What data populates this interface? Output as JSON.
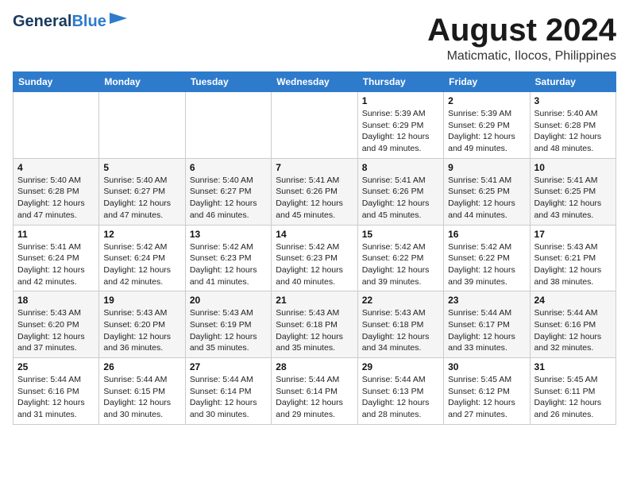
{
  "header": {
    "logo_general": "General",
    "logo_blue": "Blue",
    "title": "August 2024",
    "subtitle": "Maticmatic, Ilocos, Philippines"
  },
  "calendar": {
    "days_of_week": [
      "Sunday",
      "Monday",
      "Tuesday",
      "Wednesday",
      "Thursday",
      "Friday",
      "Saturday"
    ],
    "weeks": [
      [
        {
          "day": "",
          "info": ""
        },
        {
          "day": "",
          "info": ""
        },
        {
          "day": "",
          "info": ""
        },
        {
          "day": "",
          "info": ""
        },
        {
          "day": "1",
          "info": "Sunrise: 5:39 AM\nSunset: 6:29 PM\nDaylight: 12 hours\nand 49 minutes."
        },
        {
          "day": "2",
          "info": "Sunrise: 5:39 AM\nSunset: 6:29 PM\nDaylight: 12 hours\nand 49 minutes."
        },
        {
          "day": "3",
          "info": "Sunrise: 5:40 AM\nSunset: 6:28 PM\nDaylight: 12 hours\nand 48 minutes."
        }
      ],
      [
        {
          "day": "4",
          "info": "Sunrise: 5:40 AM\nSunset: 6:28 PM\nDaylight: 12 hours\nand 47 minutes."
        },
        {
          "day": "5",
          "info": "Sunrise: 5:40 AM\nSunset: 6:27 PM\nDaylight: 12 hours\nand 47 minutes."
        },
        {
          "day": "6",
          "info": "Sunrise: 5:40 AM\nSunset: 6:27 PM\nDaylight: 12 hours\nand 46 minutes."
        },
        {
          "day": "7",
          "info": "Sunrise: 5:41 AM\nSunset: 6:26 PM\nDaylight: 12 hours\nand 45 minutes."
        },
        {
          "day": "8",
          "info": "Sunrise: 5:41 AM\nSunset: 6:26 PM\nDaylight: 12 hours\nand 45 minutes."
        },
        {
          "day": "9",
          "info": "Sunrise: 5:41 AM\nSunset: 6:25 PM\nDaylight: 12 hours\nand 44 minutes."
        },
        {
          "day": "10",
          "info": "Sunrise: 5:41 AM\nSunset: 6:25 PM\nDaylight: 12 hours\nand 43 minutes."
        }
      ],
      [
        {
          "day": "11",
          "info": "Sunrise: 5:41 AM\nSunset: 6:24 PM\nDaylight: 12 hours\nand 42 minutes."
        },
        {
          "day": "12",
          "info": "Sunrise: 5:42 AM\nSunset: 6:24 PM\nDaylight: 12 hours\nand 42 minutes."
        },
        {
          "day": "13",
          "info": "Sunrise: 5:42 AM\nSunset: 6:23 PM\nDaylight: 12 hours\nand 41 minutes."
        },
        {
          "day": "14",
          "info": "Sunrise: 5:42 AM\nSunset: 6:23 PM\nDaylight: 12 hours\nand 40 minutes."
        },
        {
          "day": "15",
          "info": "Sunrise: 5:42 AM\nSunset: 6:22 PM\nDaylight: 12 hours\nand 39 minutes."
        },
        {
          "day": "16",
          "info": "Sunrise: 5:42 AM\nSunset: 6:22 PM\nDaylight: 12 hours\nand 39 minutes."
        },
        {
          "day": "17",
          "info": "Sunrise: 5:43 AM\nSunset: 6:21 PM\nDaylight: 12 hours\nand 38 minutes."
        }
      ],
      [
        {
          "day": "18",
          "info": "Sunrise: 5:43 AM\nSunset: 6:20 PM\nDaylight: 12 hours\nand 37 minutes."
        },
        {
          "day": "19",
          "info": "Sunrise: 5:43 AM\nSunset: 6:20 PM\nDaylight: 12 hours\nand 36 minutes."
        },
        {
          "day": "20",
          "info": "Sunrise: 5:43 AM\nSunset: 6:19 PM\nDaylight: 12 hours\nand 35 minutes."
        },
        {
          "day": "21",
          "info": "Sunrise: 5:43 AM\nSunset: 6:18 PM\nDaylight: 12 hours\nand 35 minutes."
        },
        {
          "day": "22",
          "info": "Sunrise: 5:43 AM\nSunset: 6:18 PM\nDaylight: 12 hours\nand 34 minutes."
        },
        {
          "day": "23",
          "info": "Sunrise: 5:44 AM\nSunset: 6:17 PM\nDaylight: 12 hours\nand 33 minutes."
        },
        {
          "day": "24",
          "info": "Sunrise: 5:44 AM\nSunset: 6:16 PM\nDaylight: 12 hours\nand 32 minutes."
        }
      ],
      [
        {
          "day": "25",
          "info": "Sunrise: 5:44 AM\nSunset: 6:16 PM\nDaylight: 12 hours\nand 31 minutes."
        },
        {
          "day": "26",
          "info": "Sunrise: 5:44 AM\nSunset: 6:15 PM\nDaylight: 12 hours\nand 30 minutes."
        },
        {
          "day": "27",
          "info": "Sunrise: 5:44 AM\nSunset: 6:14 PM\nDaylight: 12 hours\nand 30 minutes."
        },
        {
          "day": "28",
          "info": "Sunrise: 5:44 AM\nSunset: 6:14 PM\nDaylight: 12 hours\nand 29 minutes."
        },
        {
          "day": "29",
          "info": "Sunrise: 5:44 AM\nSunset: 6:13 PM\nDaylight: 12 hours\nand 28 minutes."
        },
        {
          "day": "30",
          "info": "Sunrise: 5:45 AM\nSunset: 6:12 PM\nDaylight: 12 hours\nand 27 minutes."
        },
        {
          "day": "31",
          "info": "Sunrise: 5:45 AM\nSunset: 6:11 PM\nDaylight: 12 hours\nand 26 minutes."
        }
      ]
    ]
  }
}
